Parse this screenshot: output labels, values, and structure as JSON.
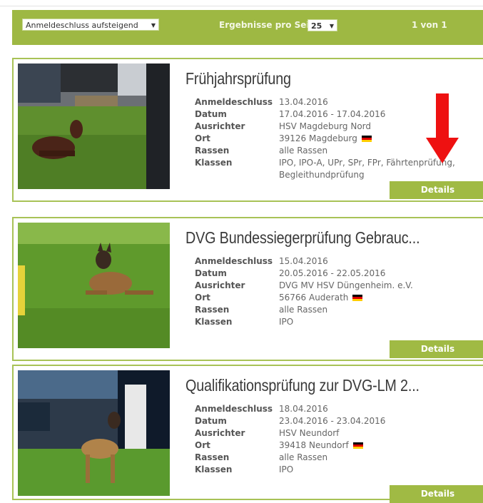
{
  "toolbar": {
    "sort_value": "Anmeldeschluss aufsteigend",
    "per_page_label": "Ergebnisse pro Seite",
    "per_page_value": "25",
    "pagination": "1 von 1"
  },
  "labels": {
    "deadline": "Anmeldeschluss",
    "date": "Datum",
    "organizer": "Ausrichter",
    "location": "Ort",
    "breeds": "Rassen",
    "classes": "Klassen",
    "details": "Details"
  },
  "events": [
    {
      "title": "Frühjahrsprüfung",
      "deadline": "13.04.2016",
      "date": "17.04.2016 - 17.04.2016",
      "organizer": "HSV Magdeburg Nord",
      "location": "39126 Magdeburg",
      "breeds": "alle Rassen",
      "classes": "IPO, IPO-A, UPr, SPr, FPr, Fährtenprüfung, Begleithundprüfung"
    },
    {
      "title": "DVG Bundessiegerprüfung Gebrauc...",
      "deadline": "15.04.2016",
      "date": "20.05.2016 - 22.05.2016",
      "organizer": "DVG MV HSV Düngenheim. e.V.",
      "location": "56766 Auderath",
      "breeds": "alle Rassen",
      "classes": "IPO"
    },
    {
      "title": "Qualifikationsprüfung zur DVG-LM 2...",
      "deadline": "18.04.2016",
      "date": "23.04.2016 - 23.04.2016",
      "organizer": "HSV Neundorf",
      "location": "39418 Neundorf",
      "breeds": "alle Rassen",
      "classes": "IPO"
    }
  ],
  "colors": {
    "accent": "#9eb843",
    "arrow": "#ee1111"
  },
  "icons": {
    "flag": "german-flag-icon",
    "arrow": "down-arrow-icon"
  }
}
